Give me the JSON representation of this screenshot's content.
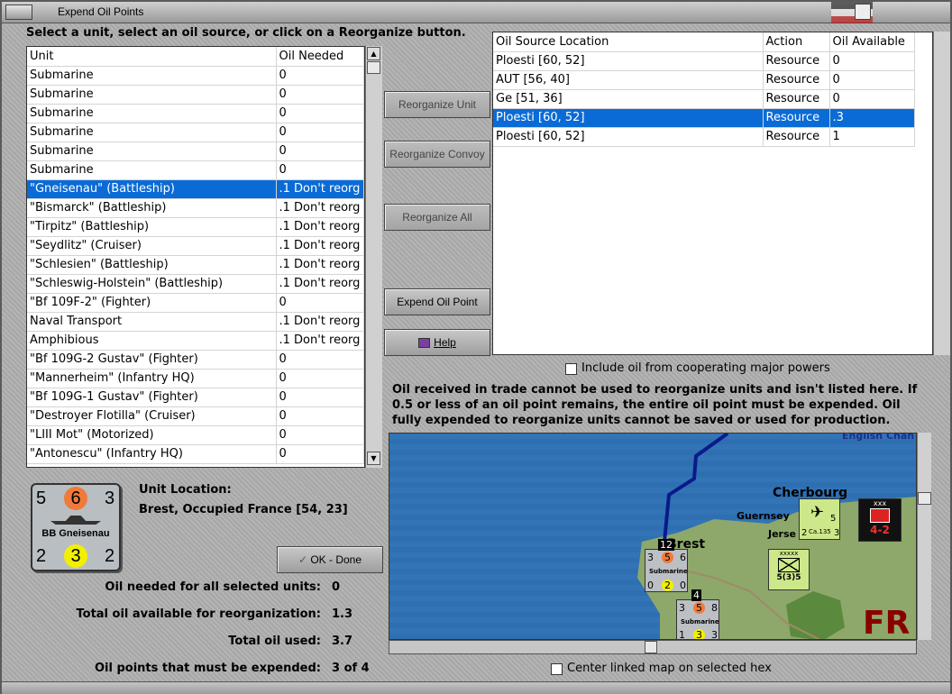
{
  "window": {
    "title": "Expend Oil Points"
  },
  "instruction": "Select a unit, select an oil source, or click on a Reorganize button.",
  "units_table": {
    "headers": [
      "Unit",
      "Oil Needed"
    ],
    "rows": [
      [
        "Submarine",
        "0"
      ],
      [
        "Submarine",
        "0"
      ],
      [
        "Submarine",
        "0"
      ],
      [
        "Submarine",
        "0"
      ],
      [
        "Submarine",
        "0"
      ],
      [
        "Submarine",
        "0"
      ],
      [
        "\"Gneisenau\" (Battleship)",
        ".1 Don't reorg"
      ],
      [
        "\"Bismarck\" (Battleship)",
        ".1 Don't reorg"
      ],
      [
        "\"Tirpitz\" (Battleship)",
        ".1 Don't reorg"
      ],
      [
        "\"Seydlitz\" (Cruiser)",
        ".1 Don't reorg"
      ],
      [
        "\"Schlesien\" (Battleship)",
        ".1 Don't reorg"
      ],
      [
        "\"Schleswig-Holstein\" (Battleship)",
        ".1 Don't reorg"
      ],
      [
        "\"Bf 109F-2\" (Fighter)",
        "0"
      ],
      [
        "Naval Transport",
        ".1 Don't reorg"
      ],
      [
        "Amphibious",
        ".1 Don't reorg"
      ],
      [
        "\"Bf 109G-2 Gustav\" (Fighter)",
        "0"
      ],
      [
        "\"Mannerheim\" (Infantry HQ)",
        "0"
      ],
      [
        "\"Bf 109G-1 Gustav\" (Fighter)",
        "0"
      ],
      [
        "\"Destroyer Flotilla\" (Cruiser)",
        "0"
      ],
      [
        "\"LIII Mot\" (Motorized)",
        "0"
      ],
      [
        "\"Antonescu\" (Infantry HQ)",
        "0"
      ]
    ],
    "selected_index": 6
  },
  "buttons": {
    "reorganize_unit": "Reorganize Unit",
    "reorganize_convoy": "Reorganize Convoy",
    "reorganize_all": "Reorganize All",
    "expend_oil_point": "Expend Oil Point",
    "help": "Help",
    "ok_done": "OK - Done"
  },
  "oil_table": {
    "headers": [
      "Oil Source Location",
      "Action",
      "Oil Available"
    ],
    "rows": [
      [
        "Ploesti [60, 52]",
        "Resource",
        "0"
      ],
      [
        "AUT [56, 40]",
        "Resource",
        "0"
      ],
      [
        "Ge [51, 36]",
        "Resource",
        "0"
      ],
      [
        "Ploesti [60, 52]",
        "Resource",
        ".3"
      ],
      [
        "Ploesti [60, 52]",
        "Resource",
        "1"
      ]
    ],
    "selected_index": 3
  },
  "include_oil_checkbox": "Include oil from cooperating major powers",
  "info_text": "Oil received in trade cannot be used to reorganize units and isn't listed here.  If 0.5 or less of an oil point remains, the entire oil point must be expended.   Oil fully expended to reorganize units cannot be saved or used for production.",
  "counter": {
    "top_left": "5",
    "top_mid": "6",
    "top_right": "3",
    "name": "BB Gneisenau",
    "bot_left": "2",
    "bot_mid": "3",
    "bot_right": "2"
  },
  "unit_location": {
    "label": "Unit Location:",
    "value": "Brest, Occupied France [54, 23]"
  },
  "summary": {
    "oil_needed_label": "Oil needed for all selected units:",
    "oil_needed": "0",
    "total_available_label": "Total oil available for reorganization:",
    "total_available": "1.3",
    "total_used_label": "Total oil used:",
    "total_used": "3.7",
    "must_expend_label": "Oil points that must be expended:",
    "must_expend": "3 of 4"
  },
  "map": {
    "labels": {
      "cherbourg": "Cherbourg",
      "guernsey": "Guernsey",
      "jersey": "Jerse",
      "brest": "Brest",
      "channel": "English Chan",
      "fr": "FR"
    },
    "sub_counter1": {
      "a": "3",
      "b": "5",
      "c": "6",
      "name": "Submarine",
      "d": "0",
      "e": "2",
      "f": "0",
      "stack": "12"
    },
    "sub_counter2": {
      "a": "3",
      "b": "5",
      "c": "8",
      "name": "Submarine",
      "d": "1",
      "e": "3",
      "f": "3",
      "stack": "4"
    },
    "inf_counter": {
      "top": "xxxxx",
      "val": "5(3)5"
    },
    "hq_counter": {
      "top": "xxx",
      "val": "4-2"
    },
    "air_counter": {
      "a": "5",
      "b": "2",
      "c": "3",
      "name": "Ca.135"
    }
  },
  "center_map_checkbox": "Center linked map on selected hex"
}
